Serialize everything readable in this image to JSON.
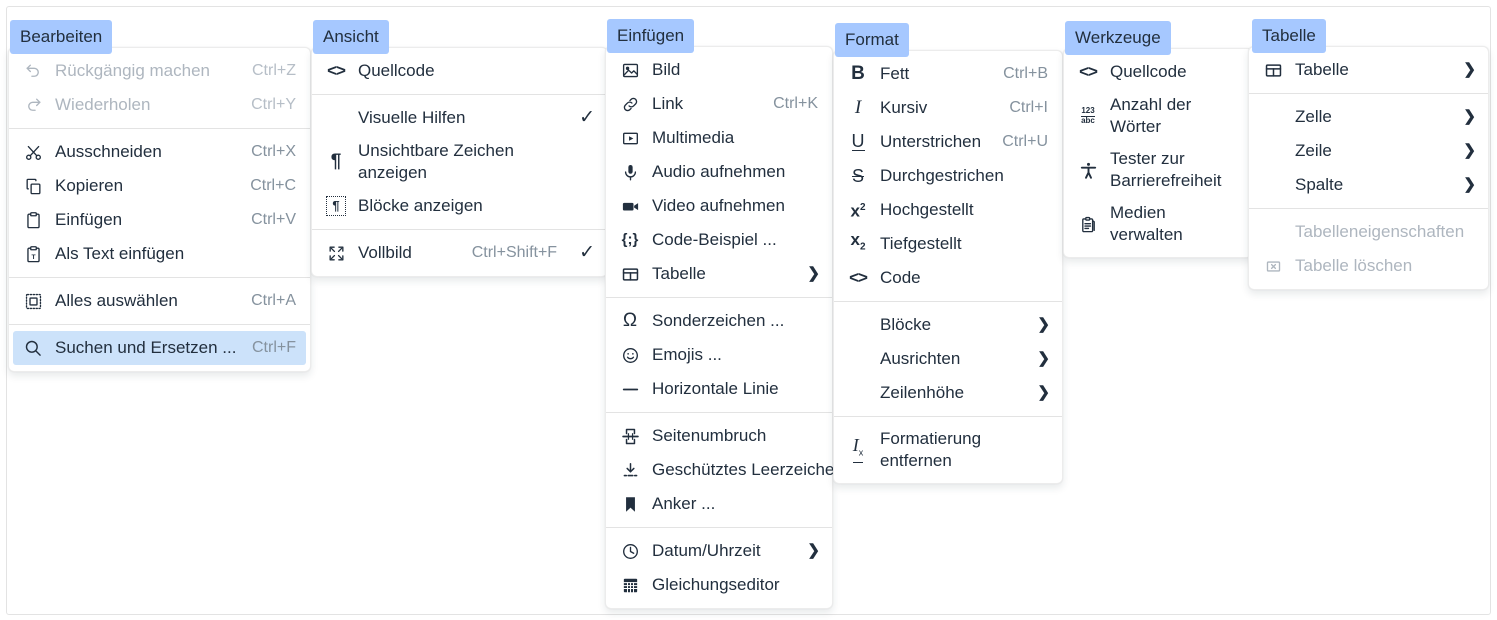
{
  "colors": {
    "tab_bg": "#a6c8ff",
    "selected_row_bg": "#cce2fa",
    "text": "#222f3e",
    "muted": "#85929e",
    "disabled": "#aeb6bf",
    "panel_bg": "#ffffff",
    "separator": "#e3e3e3"
  },
  "menus": [
    {
      "id": "edit",
      "tab_label": "Bearbeiten",
      "items": [
        {
          "icon": "undo-icon",
          "label": "Rückgängig machen",
          "accel": "Ctrl+Z",
          "disabled": true
        },
        {
          "icon": "redo-icon",
          "label": "Wiederholen",
          "accel": "Ctrl+Y",
          "disabled": true
        },
        {
          "separator": true
        },
        {
          "icon": "scissors-icon",
          "label": "Ausschneiden",
          "accel": "Ctrl+X"
        },
        {
          "icon": "copy-icon",
          "label": "Kopieren",
          "accel": "Ctrl+C"
        },
        {
          "icon": "paste-icon",
          "label": "Einfügen",
          "accel": "Ctrl+V"
        },
        {
          "icon": "paste-text-icon",
          "label": "Als Text einfügen",
          "accel": ""
        },
        {
          "separator": true
        },
        {
          "icon": "select-all-icon",
          "label": "Alles auswählen",
          "accel": "Ctrl+A"
        },
        {
          "separator": true
        },
        {
          "icon": "search-icon",
          "label": "Suchen und Ersetzen ...",
          "accel": "Ctrl+F",
          "selected": true
        }
      ]
    },
    {
      "id": "view",
      "tab_label": "Ansicht",
      "items": [
        {
          "icon": "source-code-icon",
          "label": "Quellcode",
          "accel": ""
        },
        {
          "separator": true
        },
        {
          "icon": "",
          "label": "Visuelle Hilfen",
          "accel": "",
          "checked": true
        },
        {
          "icon": "pilcrow-icon",
          "label": "Unsichtbare Zeichen anzeigen",
          "accel": "",
          "wrap": true
        },
        {
          "icon": "show-blocks-icon",
          "label": "Blöcke anzeigen",
          "accel": ""
        },
        {
          "separator": true
        },
        {
          "icon": "fullscreen-icon",
          "label": "Vollbild",
          "accel": "Ctrl+Shift+F",
          "checked": true
        }
      ]
    },
    {
      "id": "insert",
      "tab_label": "Einfügen",
      "items": [
        {
          "icon": "image-icon",
          "label": "Bild",
          "accel": ""
        },
        {
          "icon": "link-icon",
          "label": "Link",
          "accel": "Ctrl+K"
        },
        {
          "icon": "multimedia-icon",
          "label": "Multimedia",
          "accel": ""
        },
        {
          "icon": "microphone-icon",
          "label": "Audio aufnehmen",
          "accel": ""
        },
        {
          "icon": "video-camera-icon",
          "label": "Video aufnehmen",
          "accel": ""
        },
        {
          "icon": "code-sample-icon",
          "label": "Code-Beispiel ...",
          "accel": ""
        },
        {
          "icon": "table-icon",
          "label": "Tabelle",
          "accel": "",
          "submenu": true
        },
        {
          "separator": true
        },
        {
          "icon": "omega-icon",
          "label": "Sonderzeichen ...",
          "accel": ""
        },
        {
          "icon": "emoji-icon",
          "label": "Emojis ...",
          "accel": ""
        },
        {
          "icon": "horizontal-rule-icon",
          "label": "Horizontale Linie",
          "accel": ""
        },
        {
          "separator": true
        },
        {
          "icon": "page-break-icon",
          "label": "Seitenumbruch",
          "accel": ""
        },
        {
          "icon": "nbsp-icon",
          "label": "Geschütztes Leerzeichen",
          "accel": ""
        },
        {
          "icon": "anchor-icon",
          "label": "Anker ...",
          "accel": ""
        },
        {
          "separator": true
        },
        {
          "icon": "clock-icon",
          "label": "Datum/Uhrzeit",
          "accel": "",
          "submenu": true
        },
        {
          "icon": "equation-icon",
          "label": "Gleichungseditor",
          "accel": ""
        }
      ]
    },
    {
      "id": "format",
      "tab_label": "Format",
      "items": [
        {
          "icon": "bold-icon",
          "label": "Fett",
          "accel": "Ctrl+B"
        },
        {
          "icon": "italic-icon",
          "label": "Kursiv",
          "accel": "Ctrl+I"
        },
        {
          "icon": "underline-icon",
          "label": "Unterstrichen",
          "accel": "Ctrl+U"
        },
        {
          "icon": "strikethrough-icon",
          "label": "Durchgestrichen",
          "accel": ""
        },
        {
          "icon": "superscript-icon",
          "label": "Hochgestellt",
          "accel": ""
        },
        {
          "icon": "subscript-icon",
          "label": "Tiefgestellt",
          "accel": ""
        },
        {
          "icon": "code-icon",
          "label": "Code",
          "accel": ""
        },
        {
          "separator": true
        },
        {
          "icon": "",
          "label": "Blöcke",
          "accel": "",
          "submenu": true
        },
        {
          "icon": "",
          "label": "Ausrichten",
          "accel": "",
          "submenu": true
        },
        {
          "icon": "",
          "label": "Zeilenhöhe",
          "accel": "",
          "submenu": true
        },
        {
          "separator": true
        },
        {
          "icon": "clear-format-icon",
          "label": "Formatierung entfernen",
          "accel": "",
          "wrap": true
        }
      ]
    },
    {
      "id": "tools",
      "tab_label": "Werkzeuge",
      "items": [
        {
          "icon": "source-code-icon",
          "label": "Quellcode",
          "accel": ""
        },
        {
          "icon": "word-count-icon",
          "label": "Anzahl der Wörter",
          "accel": "",
          "wrap": true
        },
        {
          "icon": "accessibility-icon",
          "label": "Tester zur Barrierefreiheit",
          "accel": "",
          "wrap": true
        },
        {
          "icon": "media-manage-icon",
          "label": "Medien verwalten",
          "accel": "",
          "wrap": true
        }
      ]
    },
    {
      "id": "table",
      "tab_label": "Tabelle",
      "items": [
        {
          "icon": "table-icon",
          "label": "Tabelle",
          "accel": "",
          "submenu": true
        },
        {
          "separator": true
        },
        {
          "icon": "",
          "label": "Zelle",
          "accel": "",
          "submenu": true
        },
        {
          "icon": "",
          "label": "Zeile",
          "accel": "",
          "submenu": true
        },
        {
          "icon": "",
          "label": "Spalte",
          "accel": "",
          "submenu": true
        },
        {
          "separator": true
        },
        {
          "icon": "",
          "label": "Tabelleneigenschaften",
          "accel": "",
          "disabled": true
        },
        {
          "icon": "delete-table-icon",
          "label": "Tabelle löschen",
          "accel": "",
          "disabled": true
        }
      ]
    }
  ]
}
